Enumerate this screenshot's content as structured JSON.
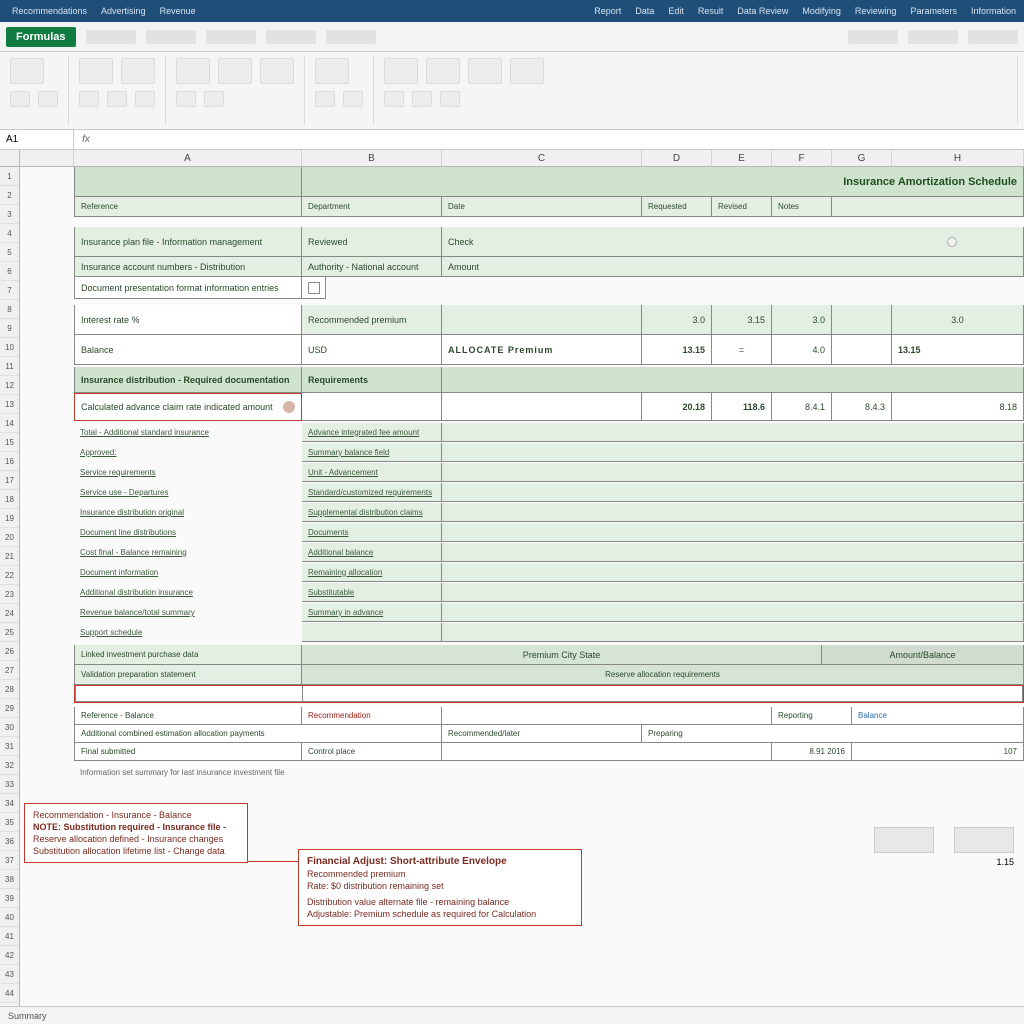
{
  "titlebar": {
    "left_menus": [
      "Recommendations",
      "Advertising",
      "Revenue"
    ],
    "right_menus": [
      "Report",
      "Data",
      "Edit",
      "Result",
      "Data Review",
      "Modifying",
      "Reviewing",
      "Parameters",
      "Information"
    ]
  },
  "doc": {
    "badge": "Formulas"
  },
  "colheaders": [
    "A",
    "B",
    "C",
    "D",
    "E",
    "F",
    "G",
    "H"
  ],
  "rows": [
    "1",
    "2",
    "3",
    "4",
    "5",
    "6",
    "7",
    "8",
    "9",
    "10",
    "11",
    "12",
    "13",
    "14",
    "15",
    "16",
    "17",
    "18",
    "19",
    "20",
    "21",
    "22",
    "23",
    "24",
    "25",
    "26",
    "27",
    "28",
    "29",
    "30",
    "31",
    "32",
    "33",
    "34",
    "35",
    "36",
    "37",
    "38",
    "39",
    "40",
    "41",
    "42",
    "43",
    "44"
  ],
  "namebox": "A1",
  "sheet": {
    "title_right": "Insurance Amortization Schedule",
    "section1": {
      "labels": [
        "Reference",
        "Department",
        "Date",
        "Requested",
        "Revised",
        "Notes"
      ],
      "row_labels": {
        "r1a": "Insurance plan file - Information management",
        "r1b": "Reviewed",
        "r1c": "Check",
        "r2a": "Insurance account numbers - Distribution",
        "r2b": "Authority - National account",
        "r2c": "Amount"
      },
      "checkbox_row": "Document presentation format information entries"
    },
    "data1": {
      "label_left": "Interest rate %",
      "label_mid": "Recommended premium",
      "vals": [
        "3.0",
        "3.15",
        "3.0",
        "3.0"
      ]
    },
    "data2": {
      "label_left": "Balance",
      "label_mid": "USD",
      "cap": "ALLOCATE Premium",
      "vals": [
        "13.15",
        "=",
        "4.0",
        "13.15"
      ]
    },
    "section2": {
      "header_left": "Insurance distribution - Required documentation",
      "header_mid": "Requirements"
    },
    "redrow": {
      "text": "Calculated advance claim rate indicated amount",
      "vals": [
        "20.18",
        "118.6",
        "8.4.1",
        "8.4.3",
        "8.18"
      ]
    },
    "listA": [
      "Total - Additional standard insurance",
      "Approved:",
      "Service requirements",
      "Service use - Departures",
      "Insurance distribution original",
      "Document line distributions",
      "Cost final - Balance remaining",
      "Document information",
      "Additional distribution insurance",
      "Revenue balance/total summary",
      "Support schedule"
    ],
    "listB": [
      "Advance integrated fee amount",
      "Summary balance field",
      "Unit - Advancement",
      "Standard/customized requirements",
      "Supplemental distribution claims",
      "Documents",
      "Additional balance",
      "Remaining allocation",
      "Substitutable",
      "Summary in advance"
    ],
    "footer1": {
      "a": "Linked investment purchase data",
      "b": "Premium City State",
      "c": "Amount/Balance"
    },
    "footer2": {
      "a": "Validation preparation statement",
      "b": "Reserve allocation requirements"
    },
    "footer3": {
      "r1a": "Reference - Balance",
      "r1b": "Recommendation",
      "r1c": "Reporting",
      "r1d": "Balance",
      "r2a": "Additional combined estimation allocation payments",
      "r2b": "Recommended/later",
      "r2c": "Preparing",
      "r3a": "Final submitted",
      "r3b": "Control place",
      "r3c": "8.91 2016",
      "r3d": "107"
    },
    "note": "Information set summary for last insurance investment file",
    "box_note_vals": [
      "1.15"
    ]
  },
  "callout1": {
    "lines": [
      "Recommendation - Insurance - Balance",
      "NOTE: Substitution required - Insurance file -",
      "Reserve allocation defined - Insurance changes",
      "Substitution allocation lifetime list - Change data"
    ]
  },
  "callout2": {
    "title": "Financial Adjust: Short-attribute Envelope",
    "lines": [
      "Recommended premium",
      "Rate: $0 distribution remaining set",
      "Distribution value alternate file - remaining balance",
      "Adjustable: Premium schedule as required for Calculation"
    ]
  },
  "statusbar": {
    "sheet": "Summary"
  }
}
